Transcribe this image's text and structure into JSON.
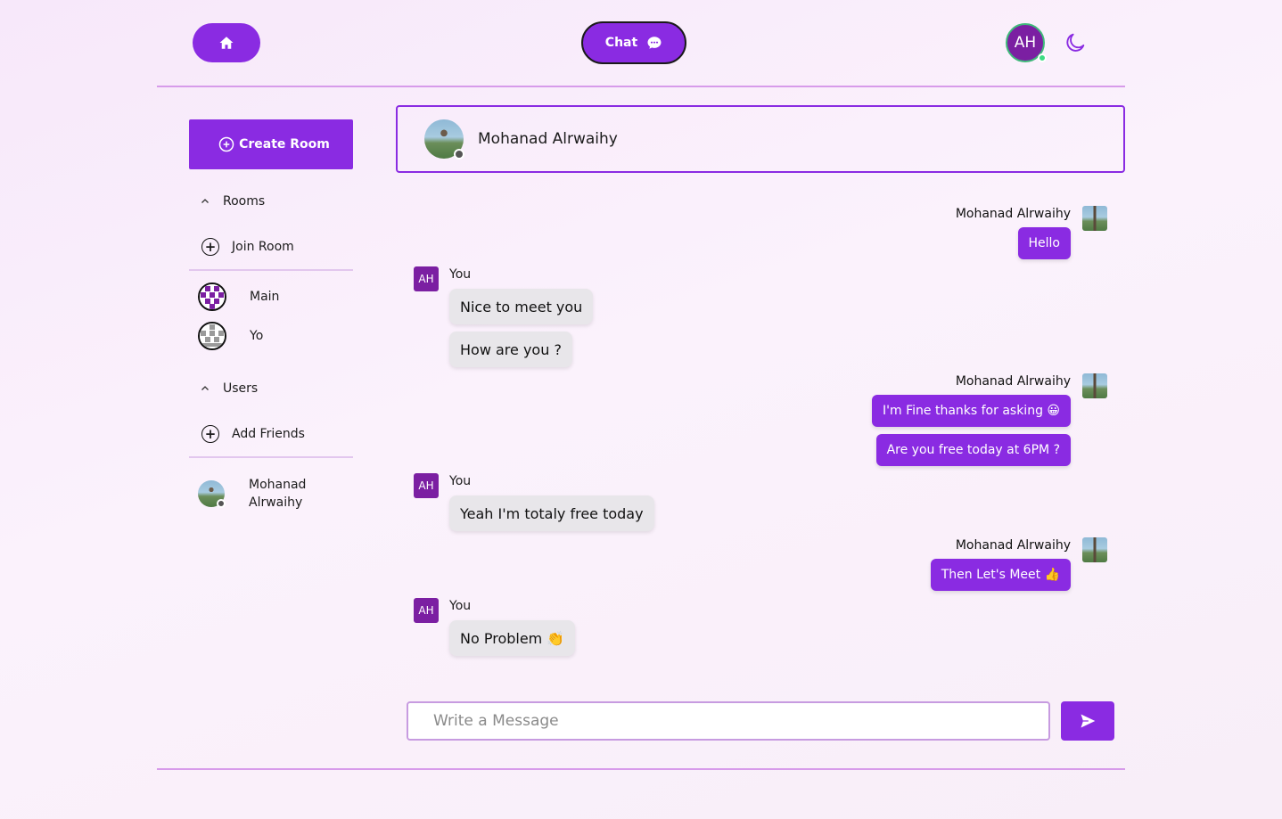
{
  "nav": {
    "home_icon": "home-icon",
    "chat_label": "Chat",
    "chat_icon": "chat-bubble-icon",
    "user_initials": "AH",
    "theme_icon": "moon-icon"
  },
  "sidebar": {
    "create_room_label": "Create Room",
    "rooms_section": "Rooms",
    "join_room_label": "Join Room",
    "rooms": [
      {
        "name": "Main"
      },
      {
        "name": "Yo"
      }
    ],
    "users_section": "Users",
    "add_friends_label": "Add Friends",
    "users": [
      {
        "name": "Mohanad Alrwaihy"
      }
    ]
  },
  "chat": {
    "header_name": "Mohanad Alrwaihy",
    "self_initials": "AH",
    "self_label": "You",
    "groups": [
      {
        "sender": "Mohanad Alrwaihy",
        "messages": [
          "Hello"
        ]
      },
      {
        "sender": "You",
        "messages": [
          "Nice to meet you",
          "How are you ?"
        ]
      },
      {
        "sender": "Mohanad Alrwaihy",
        "messages": [
          "I'm Fine thanks for asking 😀",
          "Are you free today at 6PM ?"
        ]
      },
      {
        "sender": "You",
        "messages": [
          "Yeah I'm totaly free today"
        ]
      },
      {
        "sender": "Mohanad Alrwaihy",
        "messages": [
          "Then Let's Meet 👍"
        ]
      },
      {
        "sender": "You",
        "messages": [
          "No Problem 👏"
        ]
      }
    ]
  },
  "composer": {
    "placeholder": "Write a Message",
    "value": "",
    "send_icon": "send-icon"
  },
  "colors": {
    "accent": "#8a2be2",
    "avatar": "#7b1fa2",
    "incoming_bubble": "#e8e6ea",
    "online": "#3ddc84"
  }
}
